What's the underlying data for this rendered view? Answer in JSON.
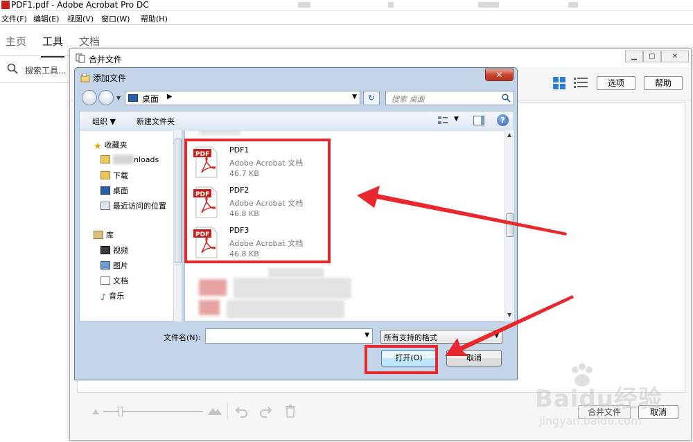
{
  "app": {
    "title": "PDF1.pdf - Adobe Acrobat Pro DC",
    "menu": [
      "文件(F)",
      "编辑(E)",
      "视图(V)",
      "窗口(W)",
      "帮助(H)"
    ],
    "tabs": [
      "主页",
      "工具",
      "文档"
    ],
    "active_tab": "工具",
    "tool_search": "搜索工具..."
  },
  "merge_window": {
    "title": "合并文件",
    "options_label": "选项",
    "help_label": "帮助",
    "combine_label": "合并文件",
    "cancel_label": "取消"
  },
  "add_dialog": {
    "title": "添加文件",
    "close_glyph": "✕",
    "address": "桌面",
    "search_placeholder": "搜索 桌面",
    "toolbar": {
      "organize": "组织 ▼",
      "new_folder": "新建文件夹"
    },
    "nav": {
      "favorites": "收藏夹",
      "downloads_partial": "nloads",
      "downloads": "下载",
      "desktop": "桌面",
      "recent": "最近访问的位置",
      "libraries": "库",
      "videos": "视频",
      "pictures": "图片",
      "documents": "文档",
      "music": "音乐"
    },
    "files": [
      {
        "name": "PDF1",
        "type": "Adobe Acrobat 文档",
        "size": "46.7 KB"
      },
      {
        "name": "PDF2",
        "type": "Adobe Acrobat 文档",
        "size": "46.8 KB"
      },
      {
        "name": "PDF3",
        "type": "Adobe Acrobat 文档",
        "size": "46.8 KB"
      }
    ],
    "pdf_badge": "PDF",
    "filename_label": "文件名(N):",
    "filename_value": "",
    "filter_value": "所有支持的格式",
    "open_label": "打开(O)",
    "cancel_label": "取消"
  },
  "watermark": {
    "text": "Baidu经验",
    "url": "jingyan.baidu.com"
  },
  "colors": {
    "annotation_red": "#e8282d",
    "pdf_red": "#c8201b",
    "dialog_frame": "#c4d5ea"
  }
}
